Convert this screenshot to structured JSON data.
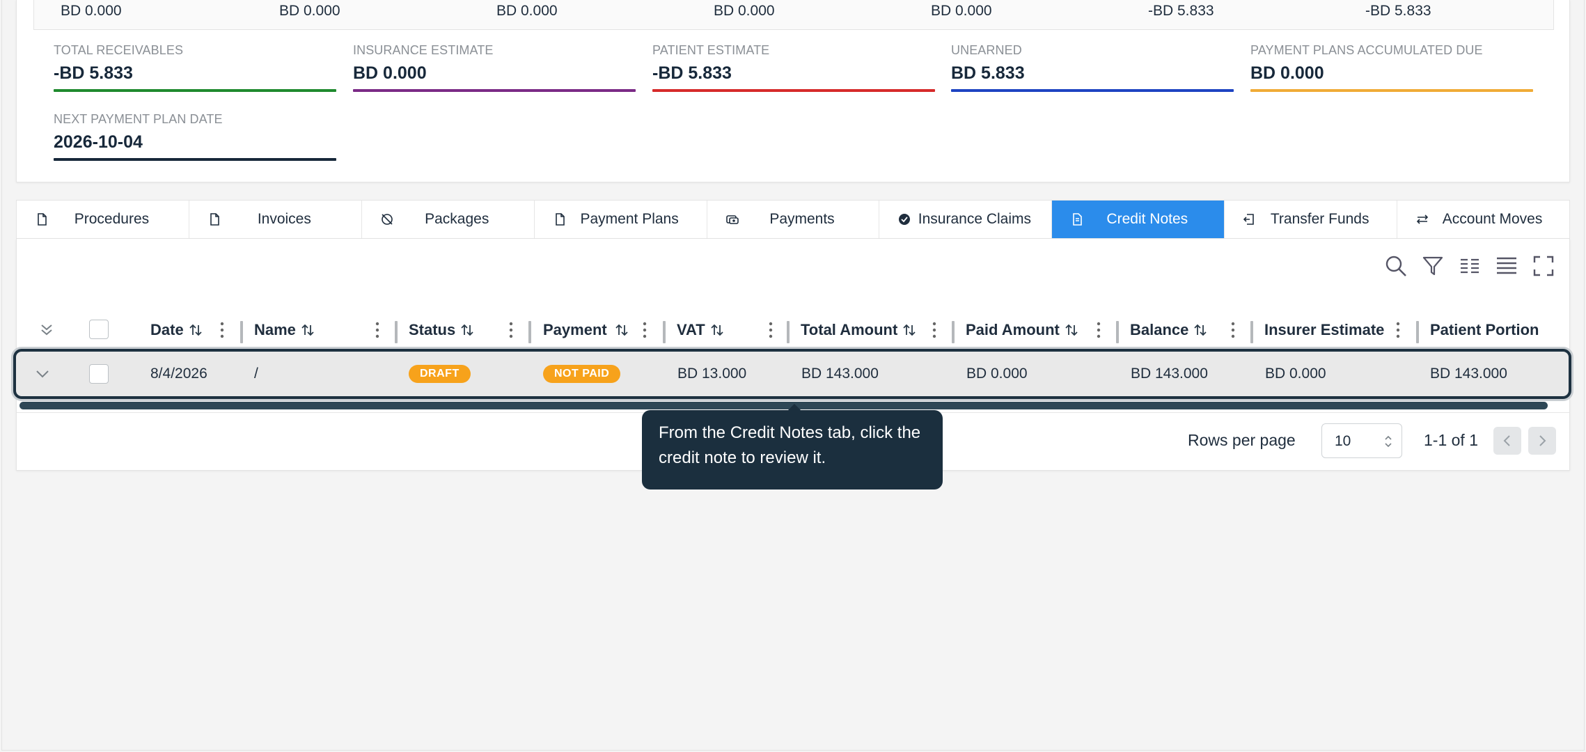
{
  "summary": {
    "totals_row": [
      "BD 0.000",
      "BD 0.000",
      "BD 0.000",
      "BD 0.000",
      "BD 0.000",
      "-BD 5.833",
      "-BD 5.833"
    ],
    "kpis": [
      {
        "label": "TOTAL RECEIVABLES",
        "value": "-BD 5.833",
        "color": "#1f8a2e"
      },
      {
        "label": "INSURANCE ESTIMATE",
        "value": "BD 0.000",
        "color": "#7b2a86"
      },
      {
        "label": "PATIENT ESTIMATE",
        "value": "-BD 5.833",
        "color": "#d62a2a"
      },
      {
        "label": "UNEARNED",
        "value": "BD 5.833",
        "color": "#1e44c2"
      },
      {
        "label": "PAYMENT PLANS ACCUMULATED DUE",
        "value": "BD 0.000",
        "color": "#f0ab37"
      },
      {
        "label": "NEXT PAYMENT PLAN DATE",
        "value": "2026-10-04",
        "color": "#17283a"
      }
    ]
  },
  "tabs": [
    {
      "label": "Procedures",
      "icon": "document-icon",
      "active": false
    },
    {
      "label": "Invoices",
      "icon": "document-icon",
      "active": false
    },
    {
      "label": "Packages",
      "icon": "package-off-icon",
      "active": false
    },
    {
      "label": "Payment Plans",
      "icon": "document-icon",
      "active": false
    },
    {
      "label": "Payments",
      "icon": "payments-icon",
      "active": false
    },
    {
      "label": "Insurance Claims",
      "icon": "shield-badge-icon",
      "active": false
    },
    {
      "label": "Credit Notes",
      "icon": "credit-note-icon",
      "active": true
    },
    {
      "label": "Transfer Funds",
      "icon": "transfer-icon",
      "active": false
    },
    {
      "label": "Account Moves",
      "icon": "swap-icon",
      "active": false
    }
  ],
  "table": {
    "toolbar_icons": [
      "search-icon",
      "filter-icon",
      "columns-icon",
      "density-icon",
      "fullscreen-icon"
    ],
    "columns": [
      "Date",
      "Name",
      "Status",
      "Payment",
      "VAT",
      "Total Amount",
      "Paid Amount",
      "Balance",
      "Insurer Estimate",
      "Patient Portion"
    ],
    "rows": [
      {
        "date": "8/4/2026",
        "name": "/",
        "status": "DRAFT",
        "payment": "NOT PAID",
        "vat": "BD 13.000",
        "total_amount": "BD 143.000",
        "paid_amount": "BD 0.000",
        "balance": "BD 143.000",
        "insurer_estimate": "BD 0.000",
        "patient_portion": "BD 143.000"
      }
    ],
    "status_color": "#f7a21b"
  },
  "pagination": {
    "rows_per_page_label": "Rows per page",
    "rows_per_page_value": "10",
    "range_label": "1-1 of 1"
  },
  "tooltip": {
    "text": "From the Credit Notes tab, click the credit note to review it."
  },
  "colors": {
    "accent": "#2b8ceb",
    "tooltip_bg": "#1b2f3e"
  }
}
